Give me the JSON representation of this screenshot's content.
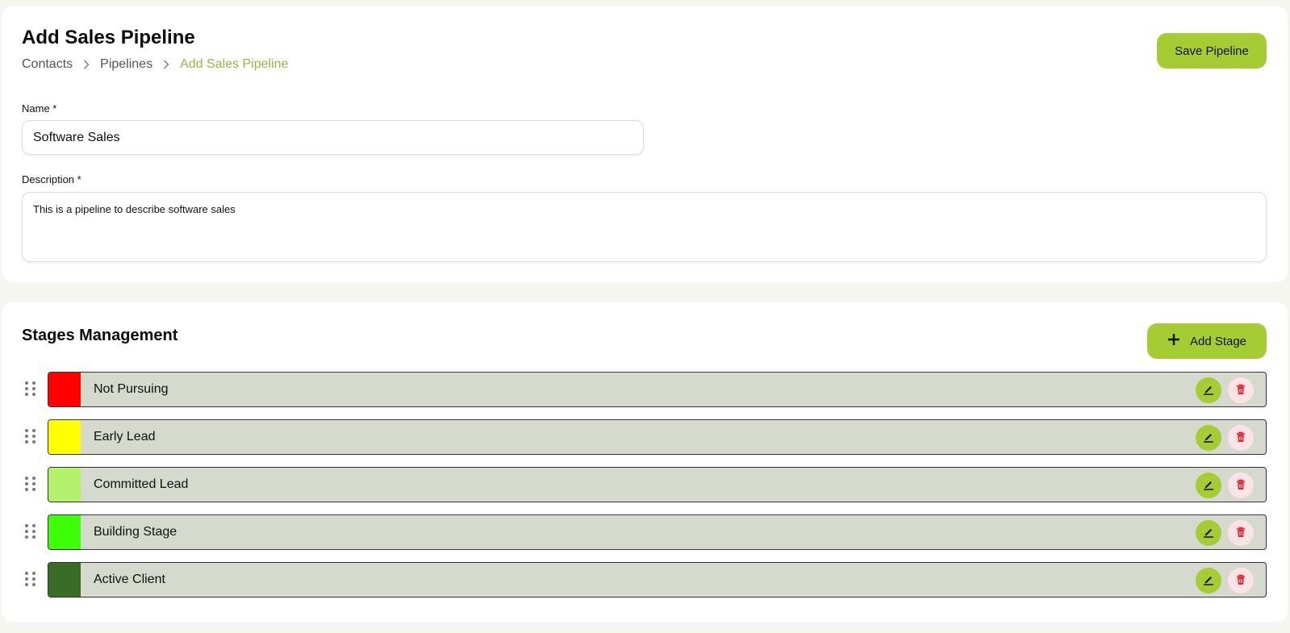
{
  "header": {
    "title": "Add Sales Pipeline",
    "breadcrumb": [
      "Contacts",
      "Pipelines",
      "Add Sales Pipeline"
    ],
    "save_label": "Save Pipeline"
  },
  "form": {
    "name_label": "Name *",
    "name_value": "Software Sales",
    "description_label": "Description *",
    "description_value": "This is a pipeline to describe software sales"
  },
  "stages": {
    "title": "Stages Management",
    "add_label": "Add Stage",
    "items": [
      {
        "label": "Not Pursuing",
        "color": "#ff0000"
      },
      {
        "label": "Early Lead",
        "color": "#ffff00"
      },
      {
        "label": "Committed Lead",
        "color": "#b3f06b"
      },
      {
        "label": "Building Stage",
        "color": "#3dff09"
      },
      {
        "label": "Active Client",
        "color": "#396d27"
      }
    ]
  },
  "colors": {
    "accent": "#a6cc33",
    "breadcrumb_active": "#9bb347",
    "stage_bar": "#d6d9ce",
    "delete_bg": "#fae3e6",
    "delete_icon": "#e0222a"
  }
}
